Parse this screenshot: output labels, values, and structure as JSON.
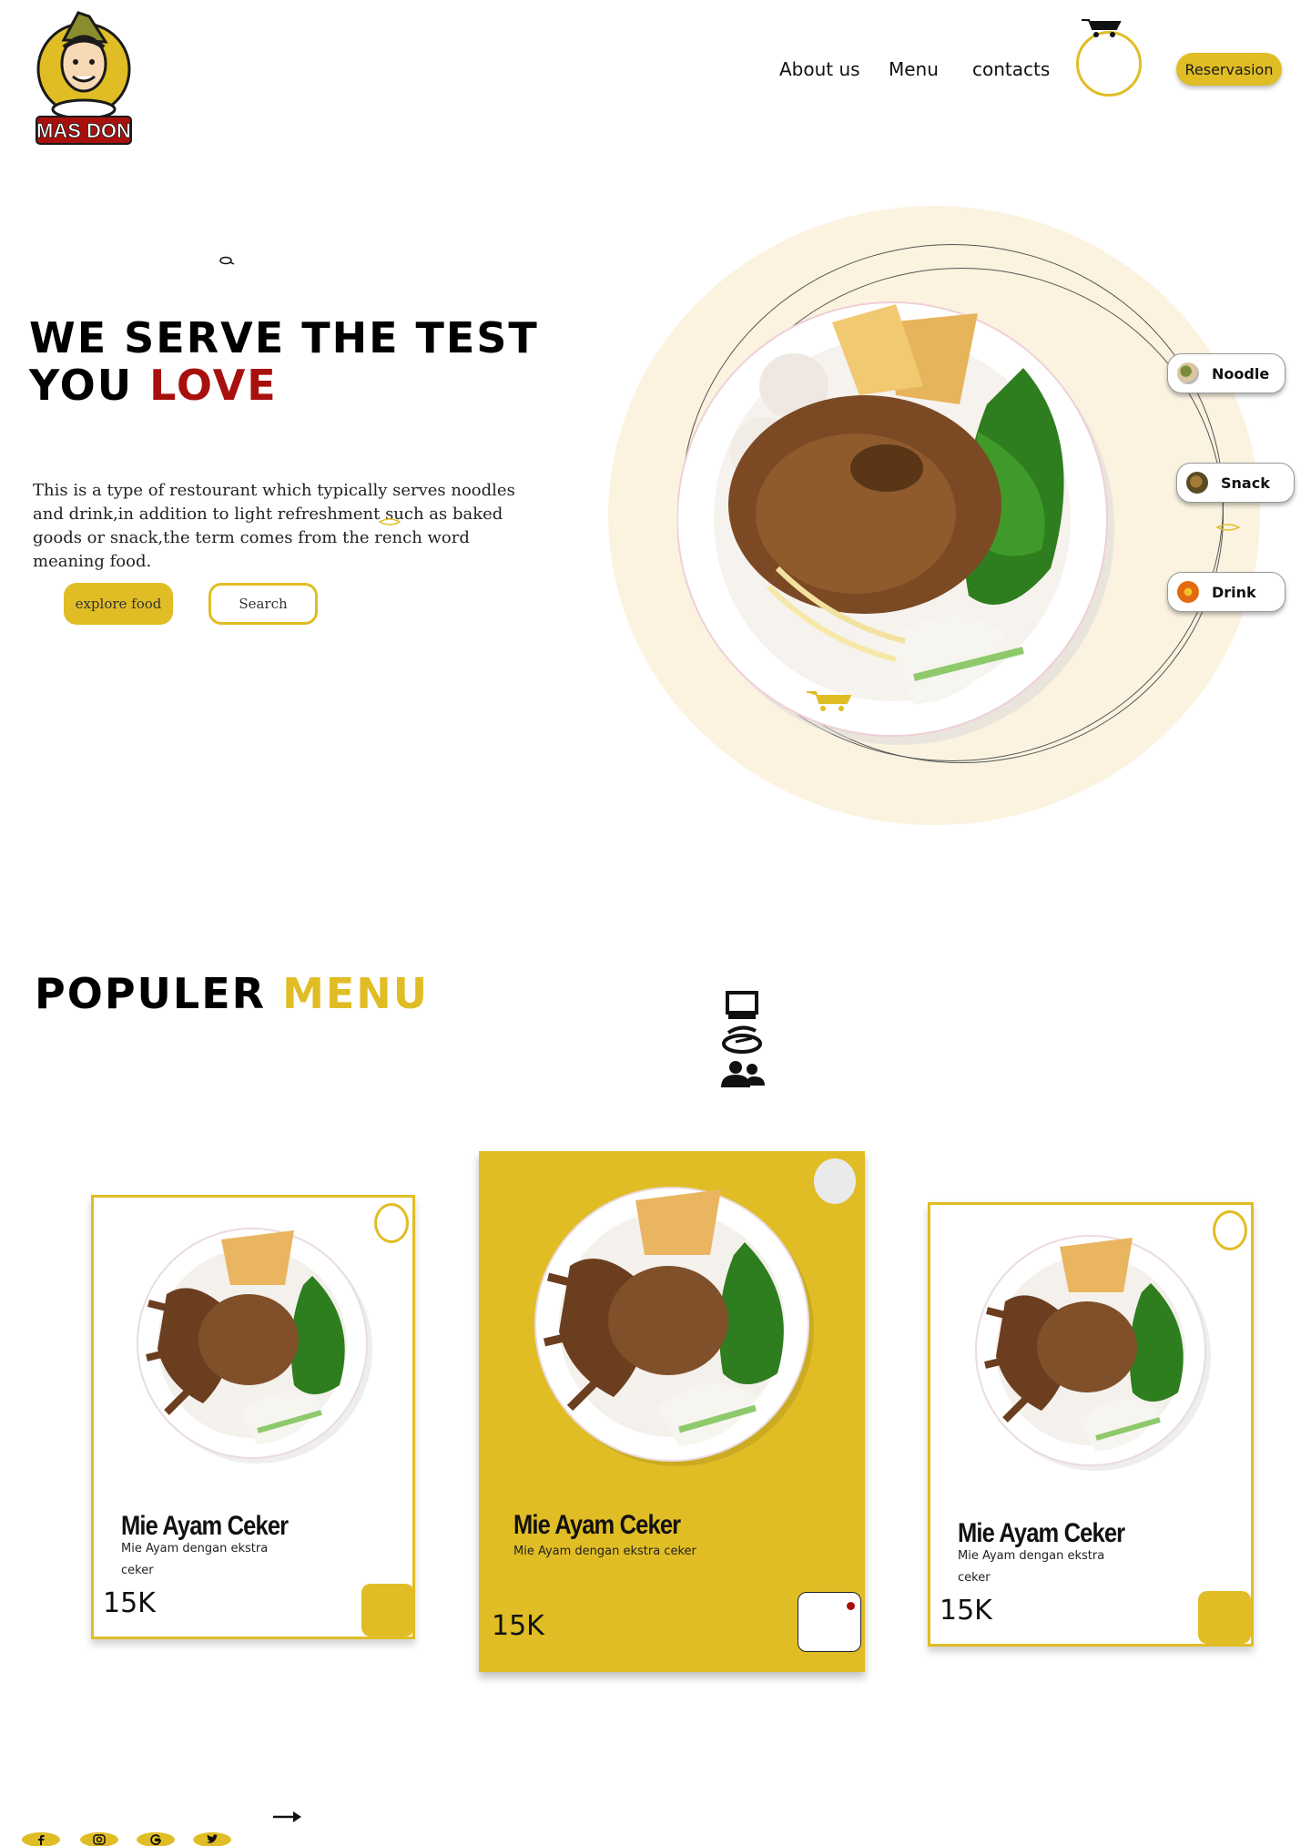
{
  "header": {
    "logo_text": "MAS DON",
    "nav": [
      "About us",
      "Menu",
      "contacts"
    ],
    "reservation_label": "Reservasion"
  },
  "hero": {
    "title_line1": "WE SERVE THE TEST",
    "title_line2_prefix": "YOU ",
    "title_line2_accent": "LOVE",
    "description": "This is a type of restourant which typically serves noodles and drink,in addition to light refreshment such as baked goods or snack,the term comes from the rench word meaning food.",
    "explore_label": "explore food",
    "search_label": "Search",
    "categories": [
      {
        "label": "Noodle"
      },
      {
        "label": "Snack"
      },
      {
        "label": "Drink"
      }
    ]
  },
  "popular": {
    "title_prefix": "POPULER ",
    "title_accent": "MENU",
    "cards": [
      {
        "name": "Mie Ayam Ceker",
        "desc": "Mie Ayam dengan ekstra ceker",
        "price": "15K"
      },
      {
        "name": "Mie Ayam Ceker",
        "desc": "Mie Ayam dengan ekstra ceker",
        "price": "15K"
      },
      {
        "name": "Mie Ayam Ceker",
        "desc": "Mie Ayam dengan ekstra ceker",
        "price": "15K"
      }
    ]
  },
  "footer": {
    "social_icons": [
      "facebook-icon",
      "instagram-icon",
      "google-icon",
      "twitter-icon"
    ]
  },
  "colors": {
    "accent": "#e0bd25",
    "love_red": "#a8100e",
    "hero_bg": "#fbf3e0"
  }
}
